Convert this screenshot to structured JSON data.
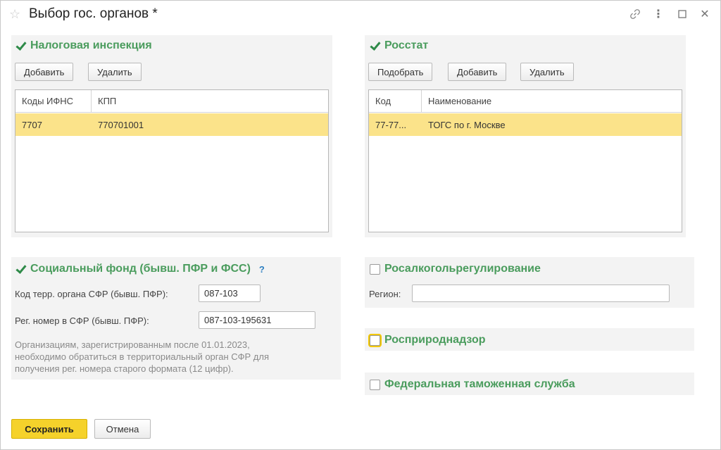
{
  "window": {
    "title": "Выбор гос. органов *",
    "icons": [
      "star-icon",
      "link-icon",
      "more-icon",
      "maximize-icon",
      "close-icon"
    ]
  },
  "tax": {
    "title": "Налоговая инспекция",
    "checked": true,
    "add_label": "Добавить",
    "delete_label": "Удалить",
    "columns": [
      "Коды ИФНС",
      "КПП"
    ],
    "rows": [
      [
        "7707",
        "770701001"
      ]
    ]
  },
  "rosstat": {
    "title": "Росстат",
    "checked": true,
    "pick_label": "Подобрать",
    "add_label": "Добавить",
    "delete_label": "Удалить",
    "columns": [
      "Код",
      "Наименование"
    ],
    "rows": [
      [
        "77-77...",
        "ТОГС по г. Москве"
      ]
    ]
  },
  "sfr": {
    "title": "Социальный фонд (бывш. ПФР и ФСС)",
    "checked": true,
    "help": "?",
    "code_label": "Код терр. органа СФР (бывш. ПФР):",
    "code_value": "087-103",
    "reg_label": "Рег. номер в СФР (бывш. ПФР):",
    "reg_value": "087-103-195631",
    "note_lines": [
      "Организациям, зарегистрированным после 01.01.2023,",
      "необходимо обратиться в территориальный орган СФР для",
      "получения рег. номера старого формата (12 цифр)."
    ]
  },
  "alco": {
    "title": "Росалкогольрегулирование",
    "checked": false,
    "region_label": "Регион:",
    "region_value": ""
  },
  "nature": {
    "title": "Росприроднадзор",
    "checked": false
  },
  "customs": {
    "title": "Федеральная таможенная служба",
    "checked": false
  },
  "footer": {
    "save_label": "Сохранить",
    "cancel_label": "Отмена"
  },
  "colors": {
    "accent_green": "#4a9c5d",
    "selection": "#fbe38a",
    "primary_button": "#f5d22b",
    "panel_bg": "#f3f3f3"
  }
}
